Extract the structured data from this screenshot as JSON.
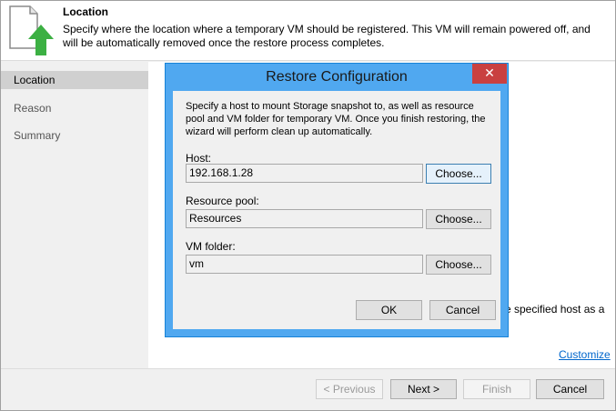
{
  "header": {
    "title": "Location",
    "description": "Specify where the location where a temporary VM should be registered. This VM will remain powered off, and will be automatically removed once the restore process completes."
  },
  "nav": {
    "items": [
      {
        "label": "Location"
      },
      {
        "label": "Reason"
      },
      {
        "label": "Summary"
      }
    ]
  },
  "content": {
    "behind_text": "e specified host as a",
    "customize_link": "Customize"
  },
  "footer": {
    "previous": "< Previous",
    "next": "Next >",
    "finish": "Finish",
    "cancel": "Cancel"
  },
  "dialog": {
    "title": "Restore Configuration",
    "close_label": "✕",
    "intro": "Specify a host to mount Storage snapshot to, as well as resource pool and VM folder for temporary VM. Once you finish restoring, the wizard will perform clean up automatically.",
    "host_label": "Host:",
    "host_value": "192.168.1.28",
    "pool_label": "Resource pool:",
    "pool_value": "Resources",
    "folder_label": "VM folder:",
    "folder_value": "vm",
    "choose_label": "Choose...",
    "ok_label": "OK",
    "cancel_label": "Cancel"
  },
  "colors": {
    "dialog_frame": "#50a8f0",
    "close_button": "#c94040",
    "link": "#0066cc",
    "arrow_icon": "#3cb043"
  },
  "icons": {
    "header": "vm-restore-arrow-icon"
  }
}
